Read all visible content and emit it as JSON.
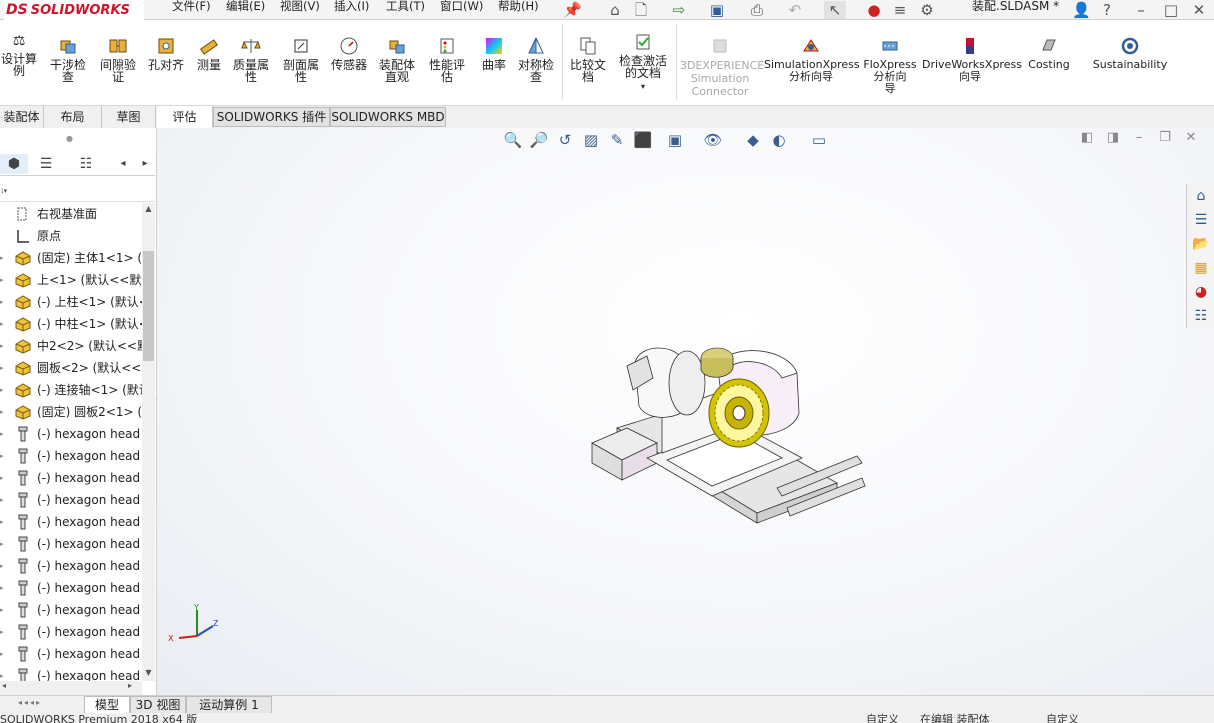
{
  "app": {
    "logo_ds": "DS",
    "logo_text": "SOLIDWORKS",
    "document_title": "装配.SLDASM *"
  },
  "menu": [
    {
      "label": "文件(F)"
    },
    {
      "label": "编辑(E)"
    },
    {
      "label": "视图(V)"
    },
    {
      "label": "插入(I)"
    },
    {
      "label": "工具(T)"
    },
    {
      "label": "窗口(W)"
    },
    {
      "label": "帮助(H)"
    }
  ],
  "ribbon": {
    "design_study": {
      "line1": "设计算",
      "line2": "例"
    },
    "interference": {
      "line1": "干涉检",
      "line2": "查"
    },
    "clearance": {
      "line1": "间隙验",
      "line2": "证"
    },
    "hole_align": "孔对齐",
    "measure": "测量",
    "mass_props": {
      "line1": "质量属",
      "line2": "性"
    },
    "section_props": {
      "line1": "剖面属",
      "line2": "性"
    },
    "sensor": "传感器",
    "assembly_visual": {
      "line1": "装配体",
      "line2": "直观"
    },
    "perf_eval": {
      "line1": "性能评",
      "line2": "估"
    },
    "curvature": "曲率",
    "symmetry": {
      "line1": "对称检",
      "line2": "查"
    },
    "compare": {
      "line1": "比较文",
      "line2": "档"
    },
    "check_active": {
      "line1": "检查激活",
      "line2": "的文档"
    },
    "sim_connector": {
      "line1": "3DEXPERIENCE",
      "line2": "Simulation",
      "line3": "Connector"
    },
    "simxpress": {
      "line1": "SimulationXpress",
      "line2": "分析向导"
    },
    "floxpress": {
      "line1": "FloXpress",
      "line2": "分析向",
      "line3": "导"
    },
    "driveworks": {
      "line1": "DriveWorksXpress",
      "line2": "向导"
    },
    "costing": "Costing",
    "sustainability": "Sustainability"
  },
  "tabs": [
    {
      "label": "装配体"
    },
    {
      "label": "布局"
    },
    {
      "label": "草图"
    },
    {
      "label": "评估"
    },
    {
      "label": "SOLIDWORKS 插件"
    },
    {
      "label": "SOLIDWORKS MBD"
    }
  ],
  "tree": [
    {
      "label": "右视基准面",
      "icon": "plane-icon"
    },
    {
      "label": "原点",
      "icon": "origin-icon"
    },
    {
      "label": "(固定) 主体1<1> (默",
      "icon": "part-icon"
    },
    {
      "label": "上<1> (默认<<默认",
      "icon": "part-icon"
    },
    {
      "label": "(-) 上柱<1> (默认<",
      "icon": "part-icon"
    },
    {
      "label": "(-) 中柱<1> (默认<",
      "icon": "part-icon"
    },
    {
      "label": "中2<2> (默认<<默",
      "icon": "part-icon"
    },
    {
      "label": "圆板<2> (默认<<默",
      "icon": "part-icon"
    },
    {
      "label": "(-) 连接轴<1> (默认",
      "icon": "part-icon"
    },
    {
      "label": "(固定) 圆板2<1> (默",
      "icon": "part-icon"
    },
    {
      "label": "(-) hexagon head",
      "icon": "bolt-icon"
    },
    {
      "label": "(-) hexagon head",
      "icon": "bolt-icon"
    },
    {
      "label": "(-) hexagon head",
      "icon": "bolt-icon"
    },
    {
      "label": "(-) hexagon head",
      "icon": "bolt-icon"
    },
    {
      "label": "(-) hexagon head",
      "icon": "bolt-icon"
    },
    {
      "label": "(-) hexagon head",
      "icon": "bolt-icon"
    },
    {
      "label": "(-) hexagon head",
      "icon": "bolt-icon"
    },
    {
      "label": "(-) hexagon head",
      "icon": "bolt-icon"
    },
    {
      "label": "(-) hexagon head",
      "icon": "bolt-icon"
    },
    {
      "label": "(-) hexagon head",
      "icon": "bolt-icon"
    },
    {
      "label": "(-) hexagon head",
      "icon": "bolt-icon"
    },
    {
      "label": "(-) hexagon head",
      "icon": "bolt-icon"
    }
  ],
  "triad": {
    "x": "X",
    "y": "Y",
    "z": "Z"
  },
  "bottom_tabs": [
    {
      "label": "模型"
    },
    {
      "label": "3D 视图"
    },
    {
      "label": "运动算例 1"
    }
  ],
  "status": {
    "product": "SOLIDWORKS Premium 2018 x64 版",
    "defined": "自定义",
    "editing": "在编辑 装配体",
    "units": "自定义"
  },
  "colors": {
    "brand_red": "#d0122a",
    "accent_blue": "#2f5d9a",
    "gear_gold": "#c8b400"
  }
}
